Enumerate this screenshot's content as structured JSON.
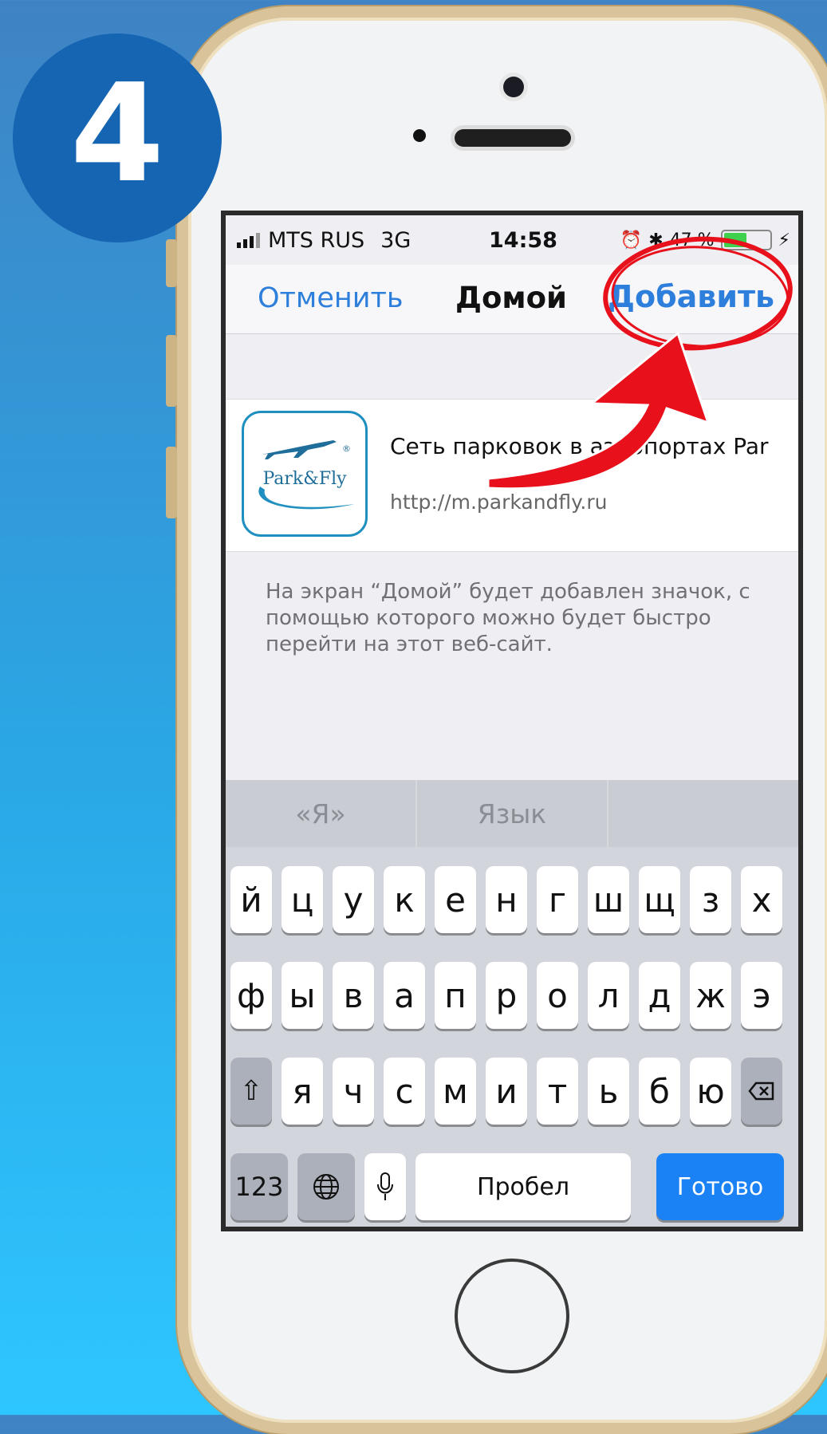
{
  "badge": {
    "step": "4"
  },
  "status_bar": {
    "carrier": "MTS RUS",
    "network": "3G",
    "time": "14:58",
    "battery": "47 %"
  },
  "nav": {
    "cancel": "Отменить",
    "title": "Домой",
    "add": "Добавить"
  },
  "bookmark": {
    "icon_text": "Park&Fly",
    "title": "Сеть парковок в аэропортах Par",
    "url": "http://m.parkandfly.ru"
  },
  "description": "На экран “Домой” будет добавлен значок, с помощью которого можно будет быстро перейти на этот веб-сайт.",
  "keyboard": {
    "suggestions": [
      "«Я»",
      "Язык",
      ""
    ],
    "row1": [
      "й",
      "ц",
      "у",
      "к",
      "е",
      "н",
      "г",
      "ш",
      "щ",
      "з",
      "х"
    ],
    "row2": [
      "ф",
      "ы",
      "в",
      "а",
      "п",
      "р",
      "о",
      "л",
      "д",
      "ж",
      "э"
    ],
    "row3": [
      "я",
      "ч",
      "с",
      "м",
      "и",
      "т",
      "ь",
      "б",
      "ю"
    ],
    "numbers": "123",
    "space": "Пробел",
    "done": "Готово"
  },
  "colors": {
    "accent": "#2d7fdb",
    "badge": "#1565b3",
    "annotation": "#e8101a"
  },
  "icons": [
    "globe-icon",
    "microphone-icon",
    "shift-icon",
    "backspace-icon",
    "alarm-icon",
    "bluetooth-icon",
    "battery-icon"
  ]
}
